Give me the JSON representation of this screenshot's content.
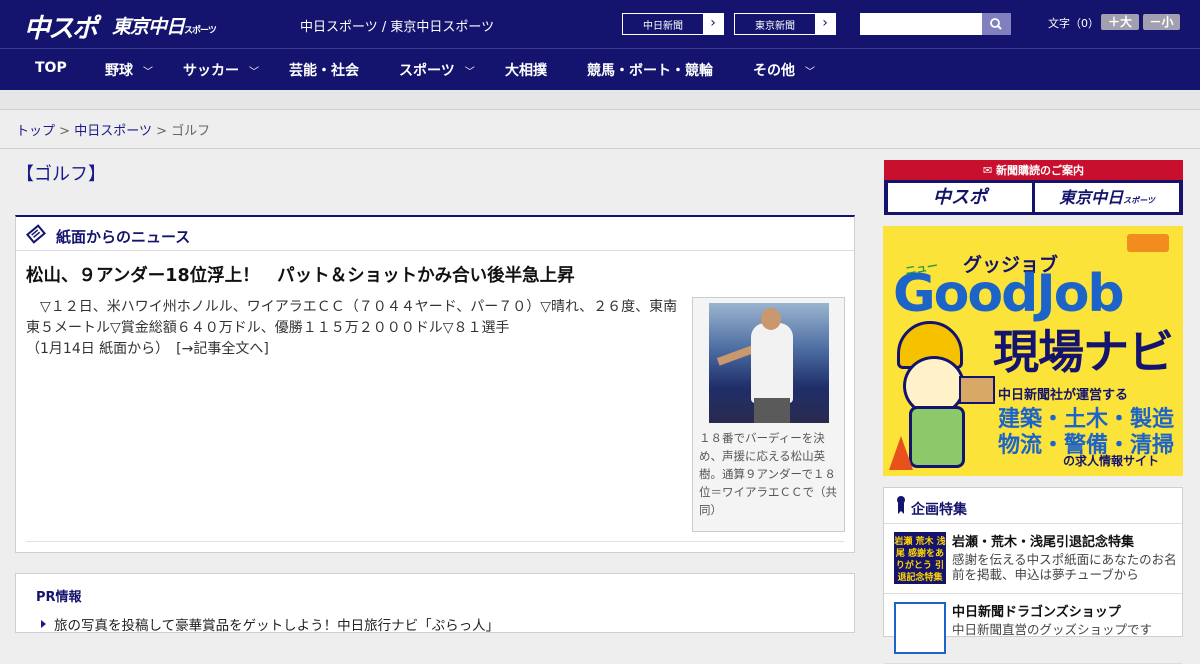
{
  "header": {
    "logo_primary": "中スポ",
    "logo_secondary": "東京中日",
    "logo_secondary_sub": "スポーツ",
    "site_title": "中日スポーツ / 東京中日スポーツ",
    "ext_links": [
      {
        "label": "中日新聞"
      },
      {
        "label": "東京新聞"
      }
    ],
    "search": {
      "value": "",
      "placeholder": ""
    },
    "font_size": {
      "label": "文字（0）",
      "larger": "＋大",
      "smaller": "－小"
    }
  },
  "nav": {
    "items": [
      {
        "label": "TOP",
        "has_menu": false
      },
      {
        "label": "野球",
        "has_menu": true
      },
      {
        "label": "サッカー",
        "has_menu": true
      },
      {
        "label": "芸能・社会",
        "has_menu": false
      },
      {
        "label": "スポーツ",
        "has_menu": true
      },
      {
        "label": "大相撲",
        "has_menu": false
      },
      {
        "label": "競馬・ボート・競輪",
        "has_menu": false
      },
      {
        "label": "その他",
        "has_menu": true
      }
    ]
  },
  "breadcrumb": {
    "items": [
      {
        "label": "トップ"
      },
      {
        "label": "中日スポーツ"
      },
      {
        "label": "ゴルフ"
      }
    ],
    "separator": ">"
  },
  "page": {
    "heading": "【ゴルフ】"
  },
  "news": {
    "section_title": "紙面からのニュース",
    "article": {
      "title": "松山、９アンダー18位浮上！　パット＆ショットかみ合い後半急上昇",
      "body": "　▽１２日、米ハワイ州ホノルル、ワイアラエＣＣ（７０４４ヤード、パー７０）▽晴れ、２６度、東南東５メートル▽賞金総額６４０万ドル、優勝１１５万２０００ドル▽８１選手",
      "meta": "（1月14日 紙面から）",
      "more_link": "[→記事全文へ]",
      "photo_caption": "１８番でバーディーを決め、声援に応える松山英樹。通算９アンダーで１８位＝ワイアラエＣＣで（共同）"
    }
  },
  "pr": {
    "title": "PR情報",
    "items": [
      "旅の写真を投稿して豪華賞品をゲットしよう！中日旅行ナビ「ぷらっ人」"
    ]
  },
  "sidebar": {
    "subscribe": {
      "title": "新聞購読のご案内",
      "buttons": [
        "中スポ",
        "東京中日"
      ],
      "button_sub": "スポーツ"
    },
    "ad": {
      "tag": "ニュー",
      "katakana": "グッジョブ",
      "brand": "GoodJob",
      "subtitle": "現場ナビ",
      "line1": "中日新聞社が運営する",
      "jobs1": "建築・土木・製造",
      "jobs2": "物流・警備・清掃",
      "line2": "の求人情報サイト"
    },
    "special": {
      "title": "企画特集",
      "items": [
        {
          "thumb_text": "岩瀬 荒木 浅尾 感謝をありがとう 引退記念特集",
          "title": "岩瀬・荒木・浅尾引退記念特集",
          "desc": "感謝を伝える中スポ紙面にあなたのお名前を掲載、申込は夢チューブから"
        },
        {
          "thumb_text": "",
          "title": "中日新聞ドラゴンズショップ",
          "desc": "中日新聞直営のグッズショップです"
        }
      ]
    }
  }
}
